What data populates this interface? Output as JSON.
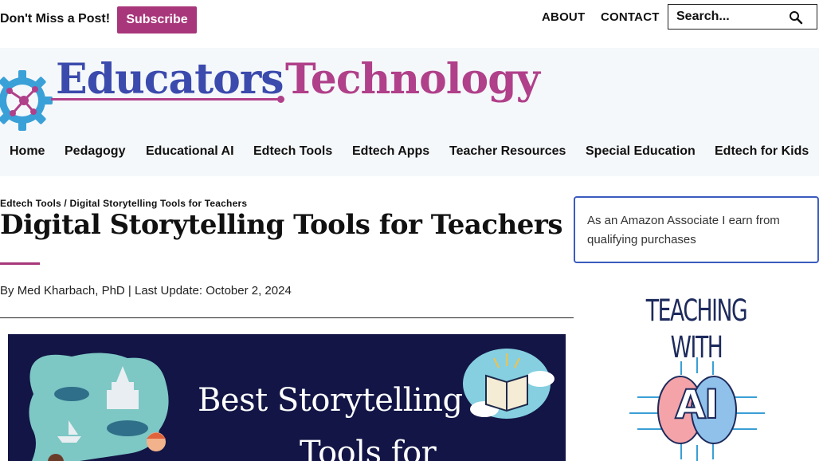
{
  "topbar": {
    "promo_text": "Don't Miss a Post!",
    "subscribe_label": "Subscribe",
    "links": {
      "about": "ABOUT",
      "contact": "CONTACT"
    },
    "search": {
      "placeholder": "Search...",
      "icon": "search-icon"
    }
  },
  "header": {
    "logo": {
      "word1": "Educators",
      "word2": "Technology",
      "icon": "gear-network-icon"
    },
    "nav": [
      "Home",
      "Pedagogy",
      "Educational AI",
      "Edtech Tools",
      "Edtech Apps",
      "Teacher Resources",
      "Special Education",
      "Edtech for Kids"
    ]
  },
  "article": {
    "breadcrumb": {
      "parent": "Edtech Tools",
      "separator": " / ",
      "current": "Digital Storytelling Tools for Teachers"
    },
    "title": "Digital Storytelling Tools for Teachers",
    "byline": {
      "prefix": "By ",
      "author": "Med Kharbach, PhD",
      "separator": " | ",
      "update_label": "Last Update: ",
      "date": "October 2, 2024"
    },
    "hero": {
      "line1": "Best Storytelling",
      "line2": "Tools for"
    }
  },
  "sidebar": {
    "affiliate_text": "As an Amazon Associate I earn from qualifying purchases",
    "book": {
      "line1": "TEACHING",
      "line2": "WITH",
      "line3": "AI"
    }
  },
  "colors": {
    "accent": "#a8367a",
    "logo_blue": "#3b4aad",
    "logo_magenta": "#b0408a",
    "header_bg": "#f5f8fa",
    "hero_bg": "#121545",
    "affiliate_border": "#3b5bbf"
  }
}
